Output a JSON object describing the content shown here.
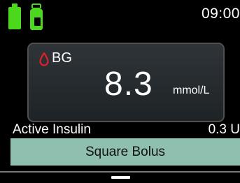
{
  "status": {
    "time": "09:00",
    "battery_icon": "battery-icon",
    "reservoir_icon": "reservoir-icon",
    "colors": {
      "battery": "#4cd81d",
      "reservoir": "#4cd81d"
    }
  },
  "bg": {
    "label": "BG",
    "value": "8.3",
    "unit": "mmol/L",
    "icon": "blood-drop-icon",
    "colors": {
      "drop": "#e0202a"
    }
  },
  "active_insulin": {
    "label": "Active Insulin",
    "value": "0.3 U"
  },
  "banner": {
    "label": "Square Bolus",
    "color": "#8fbfaf"
  }
}
